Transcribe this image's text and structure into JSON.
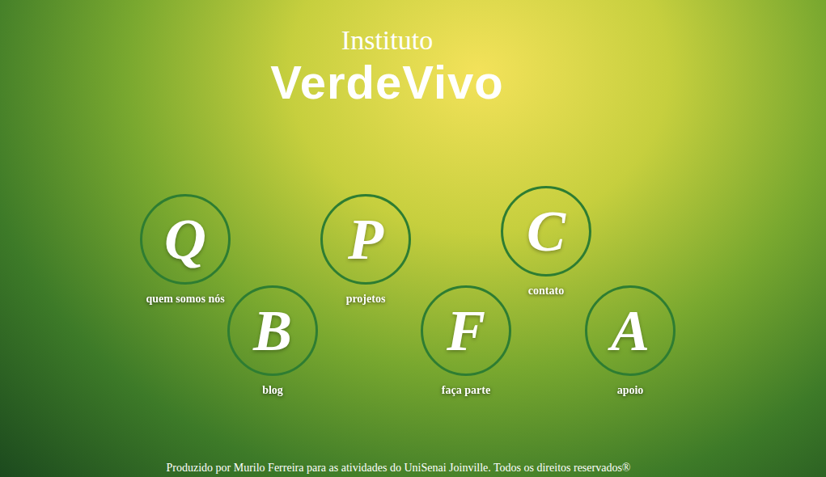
{
  "header": {
    "prefix": "Instituto",
    "name": "VerdeVivo"
  },
  "nav_rows": [
    [
      {
        "letter": "Q",
        "label": "quem somos nós"
      },
      {
        "letter": "P",
        "label": "projetos"
      },
      {
        "letter": "C",
        "label": "contato"
      }
    ],
    [
      {
        "letter": "B",
        "label": "blog"
      },
      {
        "letter": "F",
        "label": "faça parte"
      },
      {
        "letter": "A",
        "label": "apoio"
      }
    ]
  ],
  "footer": "Produzido por Murilo Ferreira para as atividades do UniSenai Joinville. Todos os direitos reservados®"
}
